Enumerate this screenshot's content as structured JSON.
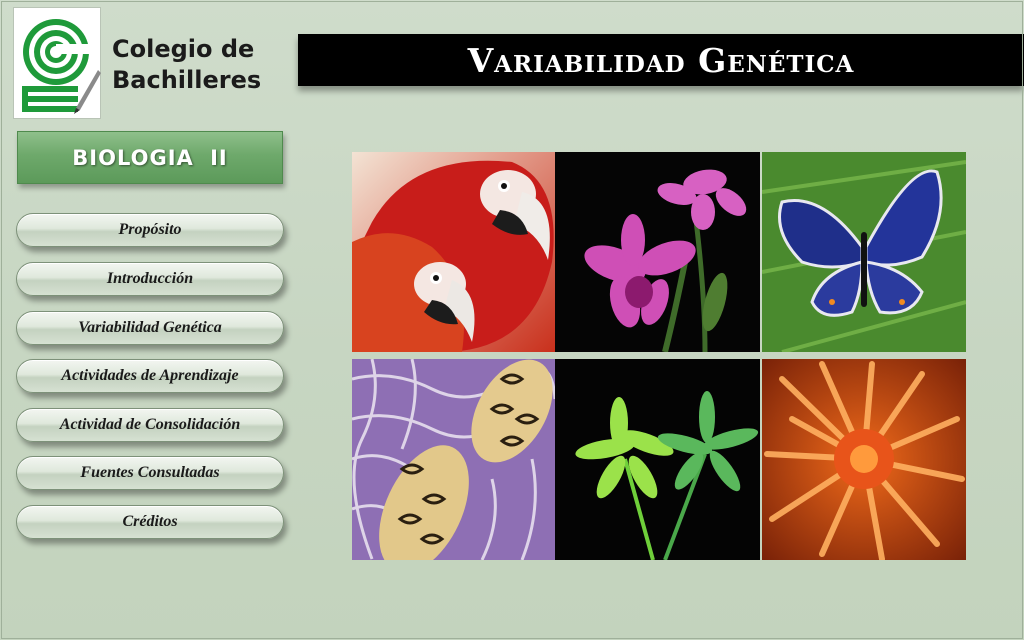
{
  "header": {
    "org_name_line1": "Colegio de",
    "org_name_line2": "Bachilleres",
    "title": "Variabilidad Genética"
  },
  "sidebar": {
    "subject": "BIOLOGIA II",
    "menu": [
      {
        "label": "Propósito"
      },
      {
        "label": "Introducción"
      },
      {
        "label": "Variabilidad Genética"
      },
      {
        "label": "Actividades de Aprendizaje"
      },
      {
        "label": "Actividad de Consolidación"
      },
      {
        "label": "Fuentes Consultadas"
      },
      {
        "label": "Créditos"
      }
    ]
  },
  "gallery": {
    "tiles": [
      {
        "icon": "macaws-image"
      },
      {
        "icon": "orchid-image"
      },
      {
        "icon": "blue-butterfly-image"
      },
      {
        "icon": "flamingo-tongue-snail-image"
      },
      {
        "icon": "green-algae-image"
      },
      {
        "icon": "orange-coral-image"
      }
    ]
  },
  "colors": {
    "background": "#cfdccb",
    "title_bar": "#000000",
    "subject_banner": "#6ea96b",
    "logo_green": "#1f9a3a"
  }
}
